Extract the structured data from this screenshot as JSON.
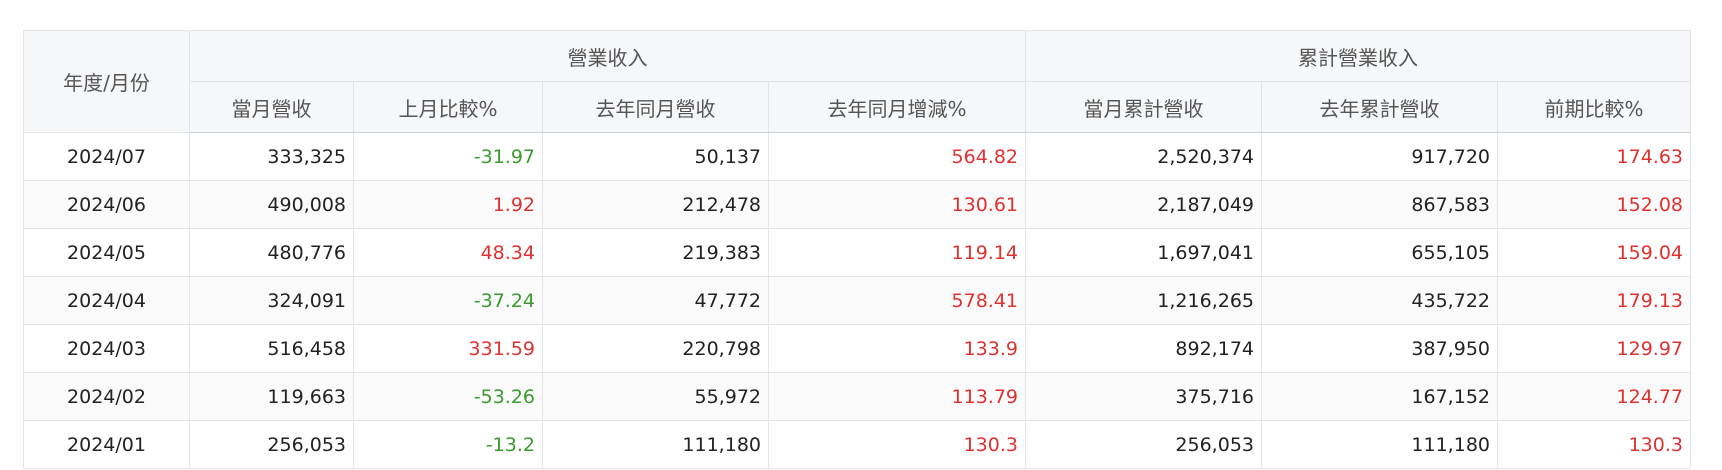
{
  "colors": {
    "positive": "#e03131",
    "negative": "#3a9b2f",
    "header_bg": "#f6f7f9",
    "border": "#e3e5e8"
  },
  "header": {
    "period": "年度/月份",
    "group_revenue": "營業收入",
    "group_cumulative": "累計營業收入",
    "columns": [
      "當月營收",
      "上月比較%",
      "去年同月營收",
      "去年同月增減%",
      "當月累計營收",
      "去年累計營收",
      "前期比較%"
    ]
  },
  "rows": [
    {
      "period": "2024/07",
      "monthly": "333,325",
      "mom": "-31.97",
      "last_year": "50,137",
      "yoy": "564.82",
      "cum": "2,520,374",
      "cum_last_year": "917,720",
      "cum_change": "174.63"
    },
    {
      "period": "2024/06",
      "monthly": "490,008",
      "mom": "1.92",
      "last_year": "212,478",
      "yoy": "130.61",
      "cum": "2,187,049",
      "cum_last_year": "867,583",
      "cum_change": "152.08"
    },
    {
      "period": "2024/05",
      "monthly": "480,776",
      "mom": "48.34",
      "last_year": "219,383",
      "yoy": "119.14",
      "cum": "1,697,041",
      "cum_last_year": "655,105",
      "cum_change": "159.04"
    },
    {
      "period": "2024/04",
      "monthly": "324,091",
      "mom": "-37.24",
      "last_year": "47,772",
      "yoy": "578.41",
      "cum": "1,216,265",
      "cum_last_year": "435,722",
      "cum_change": "179.13"
    },
    {
      "period": "2024/03",
      "monthly": "516,458",
      "mom": "331.59",
      "last_year": "220,798",
      "yoy": "133.9",
      "cum": "892,174",
      "cum_last_year": "387,950",
      "cum_change": "129.97"
    },
    {
      "period": "2024/02",
      "monthly": "119,663",
      "mom": "-53.26",
      "last_year": "55,972",
      "yoy": "113.79",
      "cum": "375,716",
      "cum_last_year": "167,152",
      "cum_change": "124.77"
    },
    {
      "period": "2024/01",
      "monthly": "256,053",
      "mom": "-13.2",
      "last_year": "111,180",
      "yoy": "130.3",
      "cum": "256,053",
      "cum_last_year": "111,180",
      "cum_change": "130.3"
    }
  ]
}
